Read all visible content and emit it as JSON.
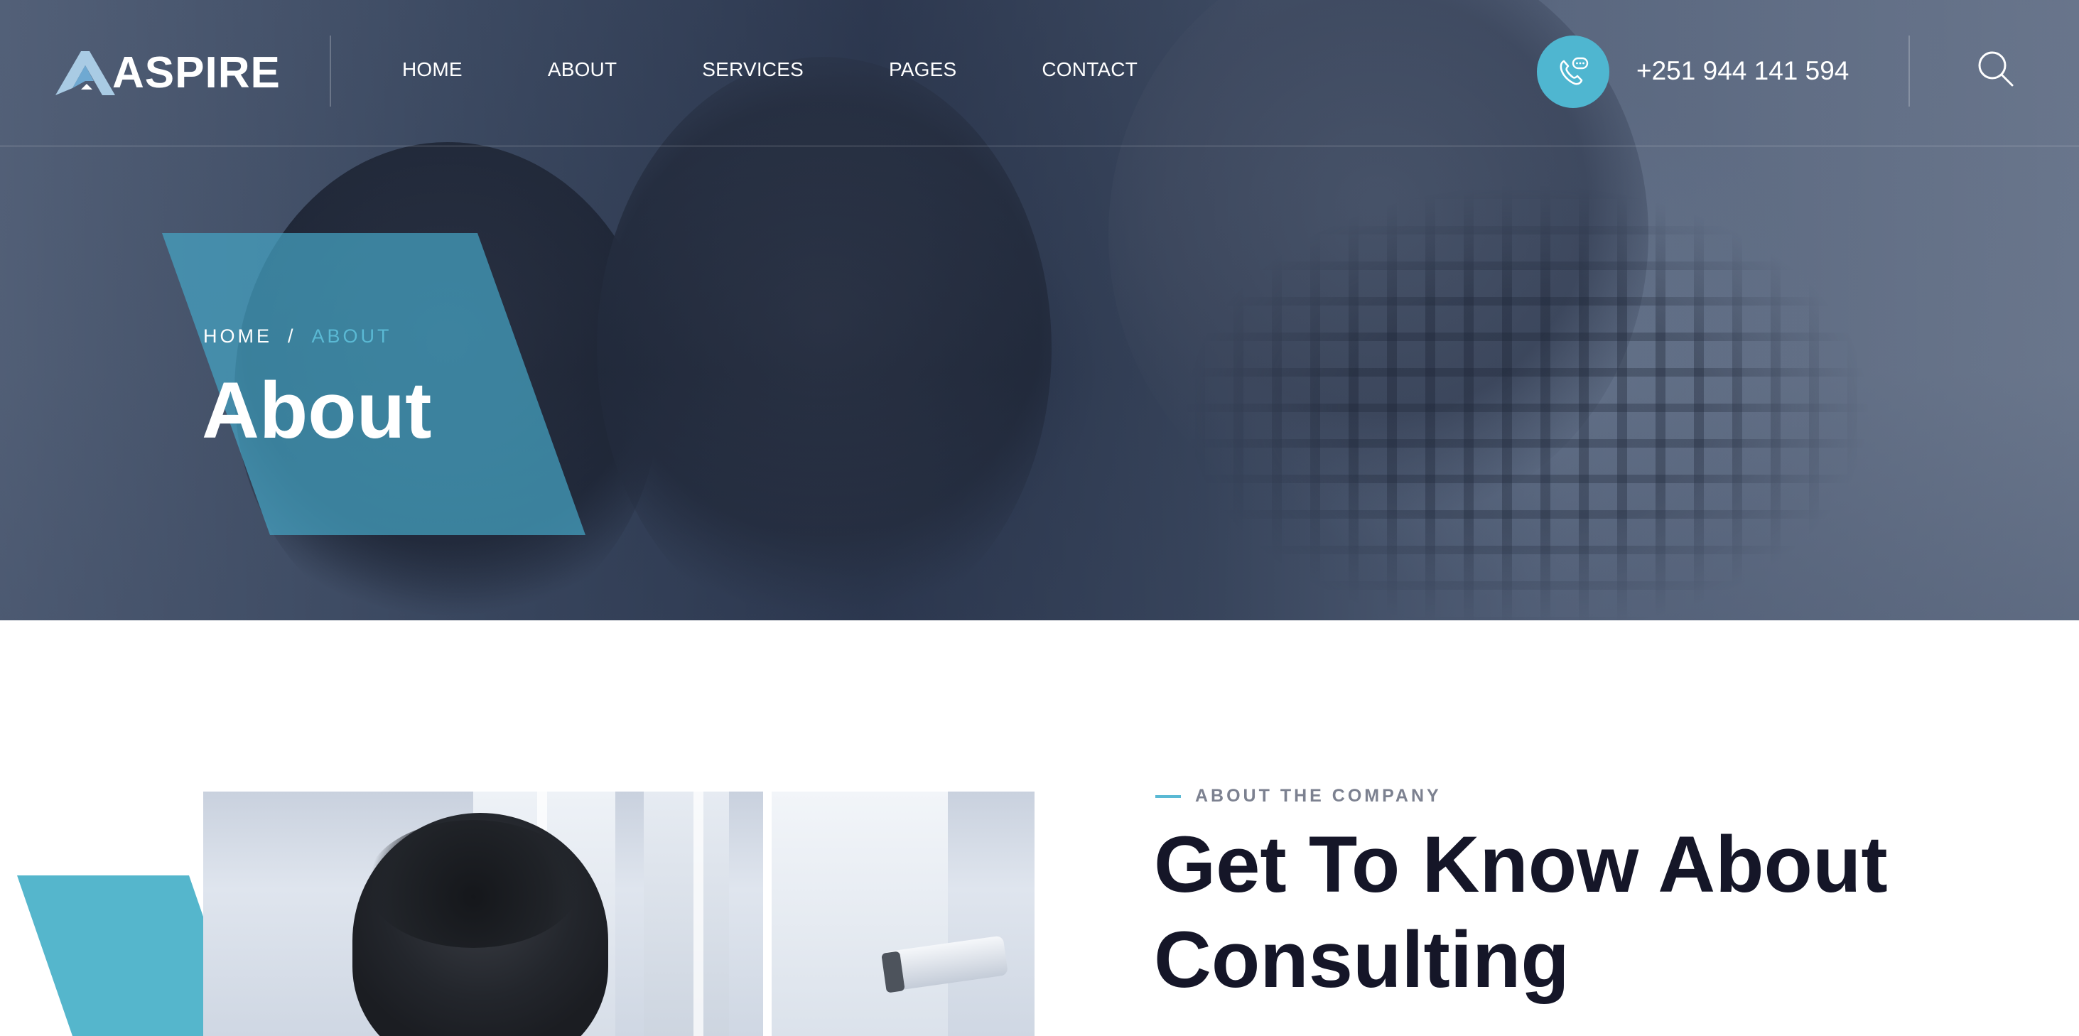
{
  "brand": {
    "name": "ASPIRE",
    "accent_color": "#4fb6d0",
    "dark_text_color": "#151628"
  },
  "nav": {
    "items": [
      {
        "label": "HOME"
      },
      {
        "label": "ABOUT"
      },
      {
        "label": "SERVICES"
      },
      {
        "label": "PAGES"
      },
      {
        "label": "CONTACT"
      }
    ]
  },
  "contact": {
    "phone": "+251 944 141 594",
    "icon": "phone-chat-icon"
  },
  "search": {
    "icon": "search-icon"
  },
  "hero": {
    "breadcrumb": {
      "home": "HOME",
      "separator": "/",
      "current": "ABOUT"
    },
    "title": "About"
  },
  "about": {
    "eyebrow": "ABOUT THE COMPANY",
    "heading_line1": "Get To Know About",
    "heading_line2": "Consulting"
  }
}
